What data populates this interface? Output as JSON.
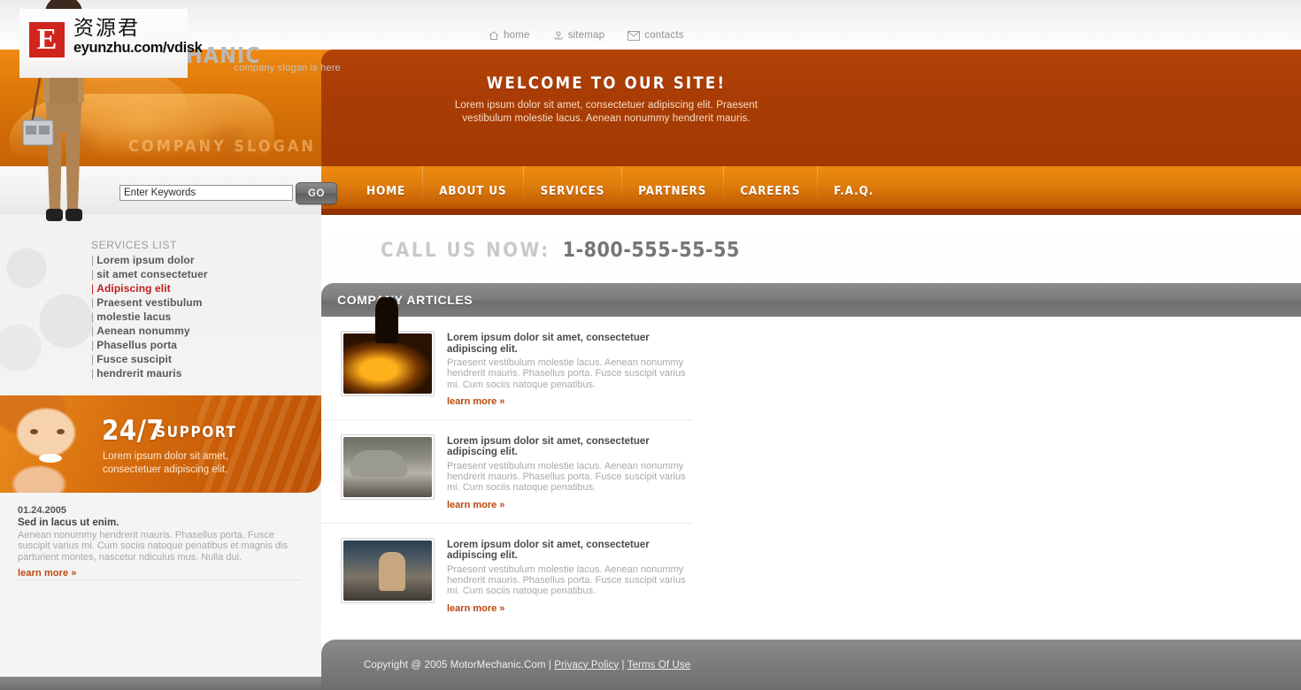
{
  "brand": {
    "logo_letter": "E",
    "logo_cn": "资源君",
    "logo_url": "eyunzhu.com/vdisk",
    "name_partial": "ECHANIC",
    "tagline": "company slogan is here",
    "header_slogan": "COMPANY  SLOGAN"
  },
  "toplinks": [
    {
      "label": "home",
      "icon": "home-icon"
    },
    {
      "label": "sitemap",
      "icon": "sitemap-icon"
    },
    {
      "label": "contacts",
      "icon": "mail-icon"
    }
  ],
  "hero": {
    "title": "WELCOME TO OUR SITE!",
    "text": "Lorem ipsum dolor sit amet, consectetuer adipiscing elit. Praesent vestibulum molestie lacus. Aenean nonummy hendrerit mauris."
  },
  "search": {
    "value": "Enter Keywords",
    "placeholder": "Enter Keywords",
    "button_label": "GO"
  },
  "mainnav": [
    {
      "label": "HOME"
    },
    {
      "label": "ABOUT US"
    },
    {
      "label": "SERVICES"
    },
    {
      "label": "PARTNERS"
    },
    {
      "label": "CAREERS"
    },
    {
      "label": "F.A.Q."
    }
  ],
  "services": {
    "title": "SERVICES LIST",
    "items": [
      {
        "label": "Lorem ipsum dolor",
        "active": false
      },
      {
        "label": "sit amet consectetuer",
        "active": false
      },
      {
        "label": "Adipiscing elit",
        "active": true
      },
      {
        "label": "Praesent vestibulum",
        "active": false
      },
      {
        "label": "molestie lacus",
        "active": false
      },
      {
        "label": "Aenean nonummy",
        "active": false
      },
      {
        "label": "Phasellus porta",
        "active": false
      },
      {
        "label": "Fusce suscipit",
        "active": false
      },
      {
        "label": "hendrerit mauris",
        "active": false
      }
    ],
    "bullet": "|"
  },
  "support": {
    "number": "24/7",
    "word": "SUPPORT",
    "text": "Lorem ipsum dolor sit amet, consectetuer adipiscing elit."
  },
  "news": {
    "date": "01.24.2005",
    "headline": "Sed in lacus ut enim.",
    "body": "Aenean nonummy hendrerit mauris. Phasellus porta. Fusce suscipit varius mi. Cum sociis natoque penatibus et magnis dis parturient montes, nascetur ndiculus mus. Nulla dui.",
    "learn_more": "learn more »"
  },
  "callus": {
    "label": "CALL US NOW:",
    "phone": "1-800-555-55-55"
  },
  "articles": {
    "heading": "COMPANY ARTICLES",
    "items": [
      {
        "title": "Lorem ipsum dolor sit amet, consectetuer adipiscing elit.",
        "body": "Praesent vestibulum molestie lacus. Aenean nonummy hendrerit mauris. Phasellus porta. Fusce suscipit varius mi. Cum sociis natoque penatibus.",
        "learn_more": "learn more »",
        "thumb": "welding-sparks-photo"
      },
      {
        "title": "Lorem ipsum dolor sit amet, consectetuer adipiscing elit.",
        "body": "Praesent vestibulum molestie lacus. Aenean nonummy hendrerit mauris. Phasellus porta. Fusce suscipit varius mi. Cum sociis natoque penatibus.",
        "learn_more": "learn more »",
        "thumb": "car-in-garage-photo"
      },
      {
        "title": "Lorem ipsum dolor sit amet, consectetuer adipiscing elit.",
        "body": "Praesent vestibulum molestie lacus. Aenean nonummy hendrerit mauris. Phasellus porta. Fusce suscipit varius mi. Cum sociis natoque penatibus.",
        "learn_more": "learn more »",
        "thumb": "mechanics-at-engine-photo"
      }
    ]
  },
  "footer": {
    "copyright": "Copyright @ 2005 MotorMechanic.Com |",
    "privacy": "Privacy Policy",
    "separator": "|",
    "terms": "Terms Of Use"
  },
  "colors": {
    "accent_orange": "#e07f0d",
    "deep_orange": "#a93c05",
    "active_red": "#c01e1e",
    "link_rust": "#b8480d",
    "gray_bar": "#7e7e7e"
  }
}
